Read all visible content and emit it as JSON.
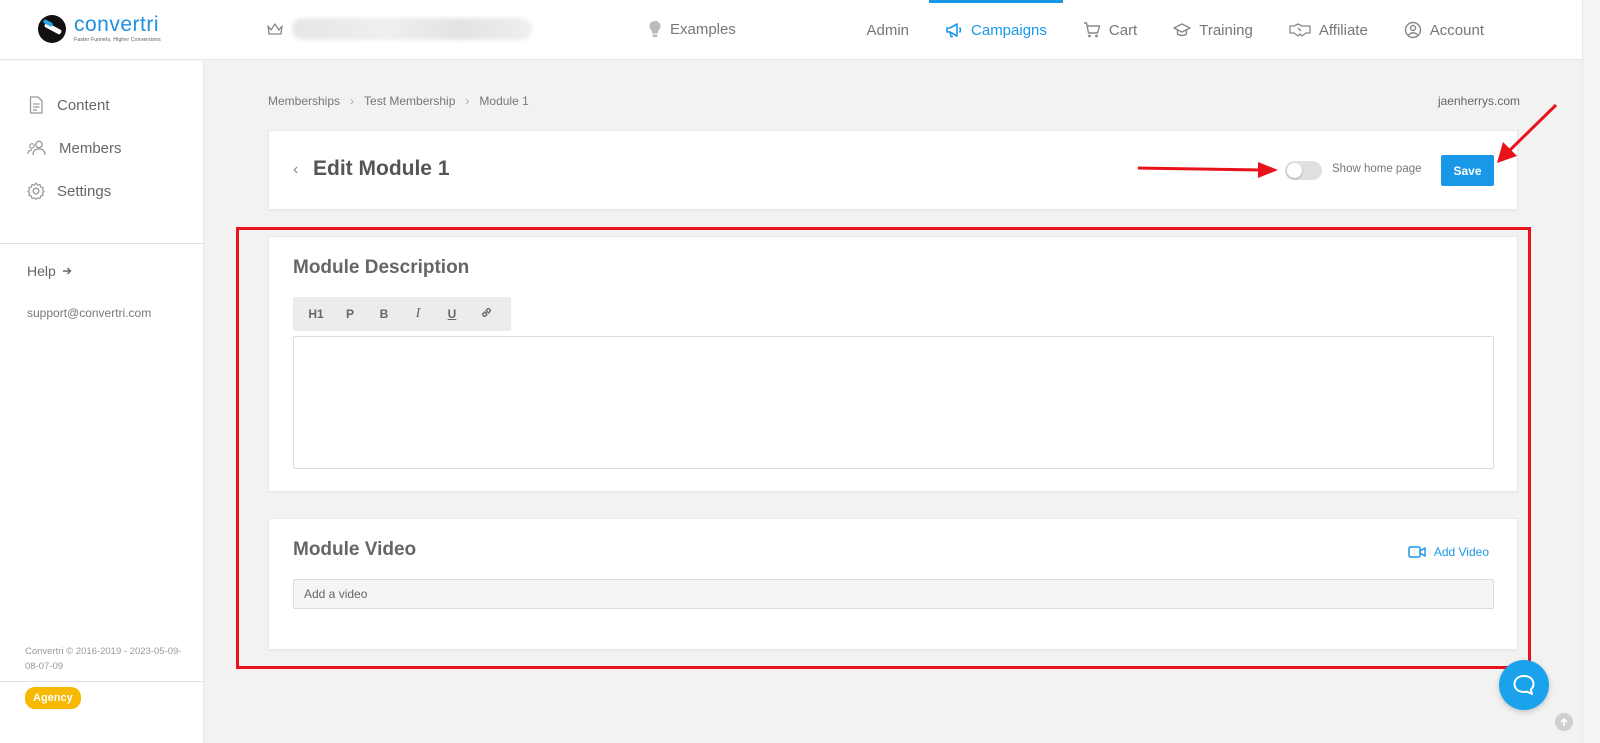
{
  "brand": {
    "name": "convertri",
    "tagline": "Faster Funnels, Higher Conversions"
  },
  "topnav": {
    "examples": "Examples",
    "items": [
      {
        "label": "Admin",
        "icon": "none"
      },
      {
        "label": "Campaigns",
        "icon": "megaphone-icon",
        "active": true
      },
      {
        "label": "Cart",
        "icon": "cart-icon"
      },
      {
        "label": "Training",
        "icon": "graduation-cap-icon"
      },
      {
        "label": "Affiliate",
        "icon": "handshake-icon"
      },
      {
        "label": "Account",
        "icon": "user-circle-icon"
      }
    ]
  },
  "sidebar": {
    "items": [
      {
        "label": "Content",
        "icon": "document-icon"
      },
      {
        "label": "Members",
        "icon": "users-icon"
      },
      {
        "label": "Settings",
        "icon": "gear-icon"
      }
    ],
    "help": "Help",
    "support": "support@convertri.com",
    "copyright": "Convertri © 2016-2019 - 2023-05-09-08-07-09",
    "badge": "Agency"
  },
  "breadcrumb": [
    "Memberships",
    "Test Membership",
    "Module 1"
  ],
  "domain": "jaenherrys.com",
  "edit": {
    "title": "Edit Module 1",
    "toggle_label": "Show home page",
    "toggle_on": false,
    "save_label": "Save"
  },
  "description": {
    "title": "Module Description",
    "toolbar": [
      "H1",
      "P",
      "B",
      "I",
      "U",
      "link"
    ],
    "content": ""
  },
  "video": {
    "title": "Module Video",
    "add_label": "Add Video",
    "placeholder": "Add a video"
  },
  "colors": {
    "accent": "#1a98e8",
    "annotation": "#e8121a",
    "badge": "#f6b800"
  }
}
